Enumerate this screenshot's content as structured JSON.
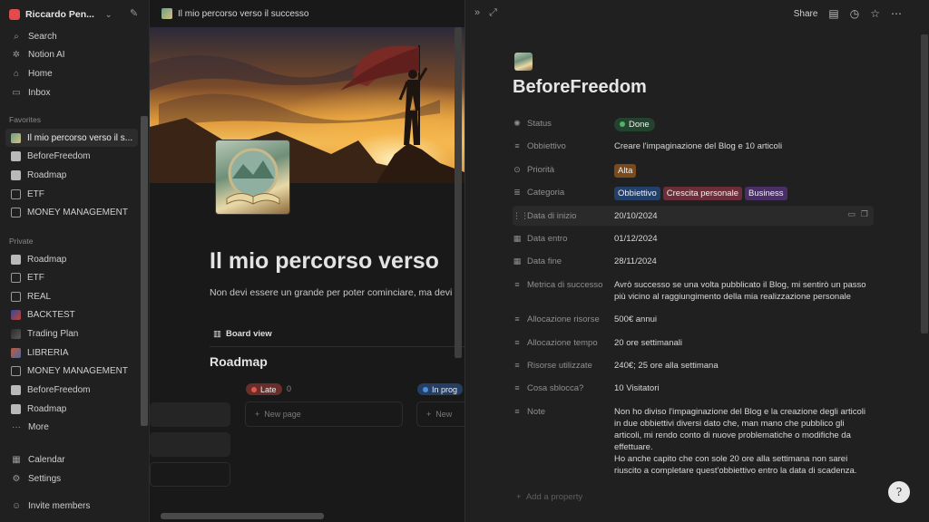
{
  "sidebar": {
    "workspace_name": "Riccardo Pen...",
    "nav": [
      {
        "label": "Search",
        "icon": "search-icon"
      },
      {
        "label": "Notion AI",
        "icon": "notion-ai-icon"
      },
      {
        "label": "Home",
        "icon": "home-icon"
      },
      {
        "label": "Inbox",
        "icon": "inbox-icon"
      }
    ],
    "favorites_label": "Favorites",
    "favorites": [
      {
        "label": "Il mio percorso verso il s..."
      },
      {
        "label": "BeforeFreedom"
      },
      {
        "label": "Roadmap"
      },
      {
        "label": "ETF"
      },
      {
        "label": "MONEY MANAGEMENT"
      }
    ],
    "private_label": "Private",
    "private": [
      {
        "label": "Roadmap"
      },
      {
        "label": "ETF"
      },
      {
        "label": "REAL"
      },
      {
        "label": "BACKTEST"
      },
      {
        "label": "Trading Plan"
      },
      {
        "label": "LIBRERIA"
      },
      {
        "label": "MONEY MANAGEMENT"
      },
      {
        "label": "BeforeFreedom"
      },
      {
        "label": "Roadmap"
      },
      {
        "label": "More"
      }
    ],
    "bottom": [
      {
        "label": "Calendar"
      },
      {
        "label": "Settings"
      }
    ],
    "invite": "Invite members"
  },
  "page": {
    "breadcrumb": "Il mio percorso verso il successo",
    "title": "Il mio percorso verso",
    "subtitle": "Non devi essere un grande per poter cominciare, ma devi",
    "board_view": "Board view",
    "section_title": "Roadmap",
    "col_late": "Late",
    "col_late_count": "0",
    "col_inprogress": "In prog",
    "new_page": "New page",
    "new_page_short": "New"
  },
  "peek": {
    "share": "Share",
    "title": "BeforeFreedom",
    "props": [
      {
        "name": "Status",
        "value": "Done"
      },
      {
        "name": "Obbiettivo",
        "value": "Creare l'impaginazione del Blog e 10 articoli"
      },
      {
        "name": "Priorità",
        "value": "Alta"
      },
      {
        "name": "Categoria",
        "tags": [
          "Obbiettivo",
          "Crescita personale",
          "Business"
        ]
      },
      {
        "name": "Data di inizio",
        "value": "20/10/2024"
      },
      {
        "name": "Data entro",
        "value": "01/12/2024"
      },
      {
        "name": "Data fine",
        "value": "28/11/2024"
      },
      {
        "name": "Metrica di successo",
        "value": "Avrò successo se una volta pubblicato il Blog, mi sentirò un passo più vicino al raggiungimento della mia realizzazione personale"
      },
      {
        "name": "Allocazione risorse",
        "value": "500€ annui"
      },
      {
        "name": "Allocazione tempo",
        "value": "20 ore settimanali"
      },
      {
        "name": "Risorse utilizzate",
        "value": "240€; 25 ore alla settimana"
      },
      {
        "name": "Cosa sblocca?",
        "value": "10 Visitatori"
      },
      {
        "name": "Note",
        "value": "Non ho diviso l'impaginazione del Blog e la creazione degli articoli in due obbiettivi diversi dato che, man mano che pubblico gli articoli, mi rendo conto di nuove problematiche o modifiche da effettuare.",
        "value2": "Ho anche capito che con sole 20 ore alla settimana non sarei riuscito a completare quest'obbiettivo entro la data di scadenza."
      }
    ],
    "add_property": "Add a property"
  }
}
